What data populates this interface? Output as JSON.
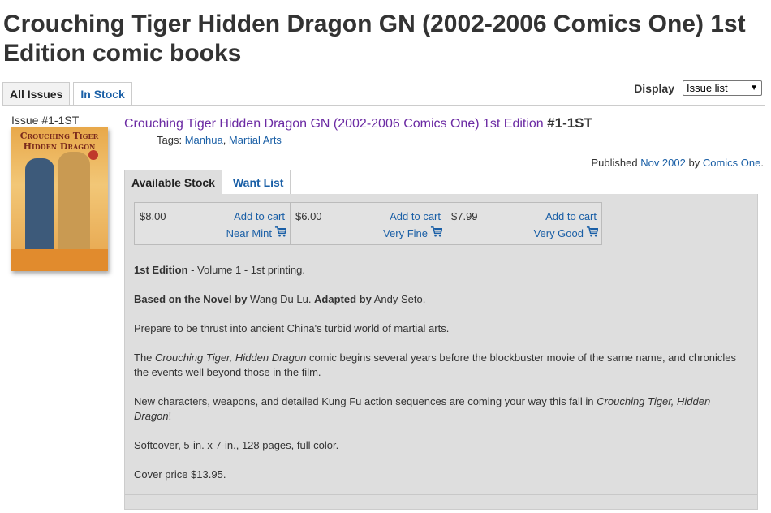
{
  "page": {
    "title": "Crouching Tiger Hidden Dragon GN (2002-2006 Comics One) 1st Edition comic books"
  },
  "top_tabs": [
    {
      "label": "All Issues"
    },
    {
      "label": "In Stock"
    }
  ],
  "display": {
    "label": "Display",
    "selected": "Issue list"
  },
  "issue": {
    "label": "Issue #1-1ST",
    "cover_title_line1": "Crouching Tiger",
    "cover_title_line2": "Hidden Dragon",
    "series_link": "Crouching Tiger Hidden Dragon GN (2002-2006 Comics One) 1st Edition",
    "number": "#1-1ST",
    "tags_label": "Tags:",
    "tags": [
      "Manhua",
      "Martial Arts"
    ],
    "published_prefix": "Published",
    "published_date": "Nov 2002",
    "published_by": "by",
    "publisher": "Comics One",
    "published_suffix": "."
  },
  "stock_tabs": [
    {
      "label": "Available Stock"
    },
    {
      "label": "Want List"
    }
  ],
  "offers": [
    {
      "price": "$8.00",
      "add_label": "Add to cart",
      "condition": "Near Mint"
    },
    {
      "price": "$6.00",
      "add_label": "Add to cart",
      "condition": "Very Fine"
    },
    {
      "price": "$7.99",
      "add_label": "Add to cart",
      "condition": "Very Good"
    }
  ],
  "description": {
    "p1_bold": "1st Edition",
    "p1_rest": " - Volume 1 - 1st printing.",
    "p2_bold1": "Based on the Novel by",
    "p2_text1": " Wang Du Lu. ",
    "p2_bold2": "Adapted by",
    "p2_text2": " Andy Seto.",
    "p3": "Prepare to be thrust into ancient China's turbid world of martial arts.",
    "p4_pre": "The ",
    "p4_italic": "Crouching Tiger, Hidden Dragon",
    "p4_post": " comic begins several years before the blockbuster movie of the same name, and chronicles the events well beyond those in the film.",
    "p5_pre": "New characters, weapons, and detailed Kung Fu action sequences are coming your way this fall in ",
    "p5_italic": "Crouching Tiger, Hidden Dragon",
    "p5_post": "!",
    "p6": "Softcover, 5-in. x 7-in., 128 pages, full color.",
    "p7": "Cover price $13.95."
  },
  "colors": {
    "link": "#1a5fa6",
    "series_link": "#6b2aa3",
    "panel_bg": "#dedede"
  }
}
